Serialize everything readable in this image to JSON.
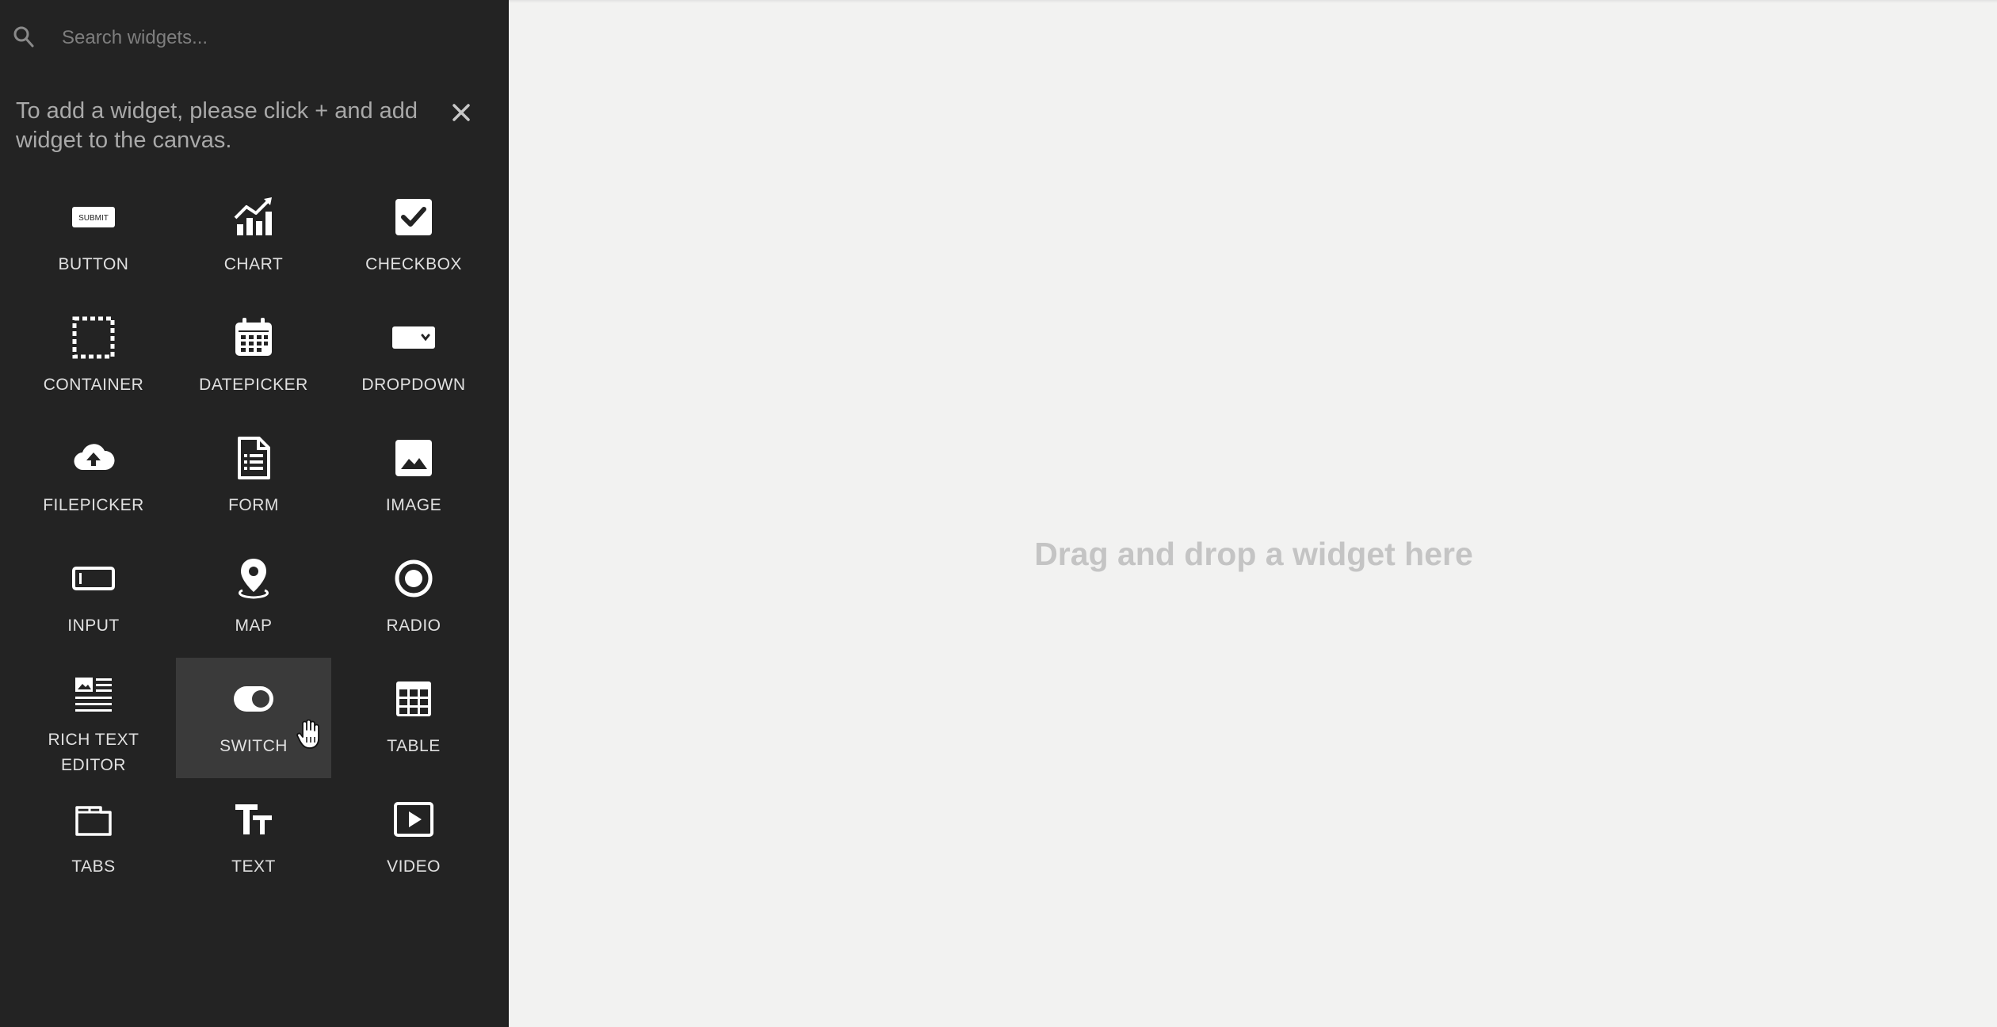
{
  "search": {
    "placeholder": "Search widgets...",
    "icon": "search-icon"
  },
  "hint": {
    "text": "To add a widget, please click + and add widget to the canvas."
  },
  "widgets": [
    {
      "label": "BUTTON",
      "icon": "button-icon"
    },
    {
      "label": "CHART",
      "icon": "chart-icon"
    },
    {
      "label": "CHECKBOX",
      "icon": "checkbox-icon"
    },
    {
      "label": "CONTAINER",
      "icon": "container-icon"
    },
    {
      "label": "DATEPICKER",
      "icon": "calendar-icon"
    },
    {
      "label": "DROPDOWN",
      "icon": "dropdown-icon"
    },
    {
      "label": "FILEPICKER",
      "icon": "cloud-upload-icon"
    },
    {
      "label": "FORM",
      "icon": "form-icon"
    },
    {
      "label": "IMAGE",
      "icon": "image-icon"
    },
    {
      "label": "INPUT",
      "icon": "input-icon"
    },
    {
      "label": "MAP",
      "icon": "map-pin-icon"
    },
    {
      "label": "RADIO",
      "icon": "radio-icon"
    },
    {
      "label": "RICH TEXT EDITOR",
      "icon": "rich-text-icon"
    },
    {
      "label": "SWITCH",
      "icon": "switch-icon"
    },
    {
      "label": "TABLE",
      "icon": "table-icon"
    },
    {
      "label": "TABS",
      "icon": "tabs-icon"
    },
    {
      "label": "TEXT",
      "icon": "text-icon"
    },
    {
      "label": "VIDEO",
      "icon": "video-icon"
    }
  ],
  "button_icon_text": "SUBMIT",
  "active_widget": "SWITCH",
  "canvas": {
    "placeholder": "Drag and drop a widget here"
  },
  "colors": {
    "sidebar_bg": "#232323",
    "canvas_bg": "#f2f2f1",
    "active_tile_bg": "#3a3a3a"
  }
}
